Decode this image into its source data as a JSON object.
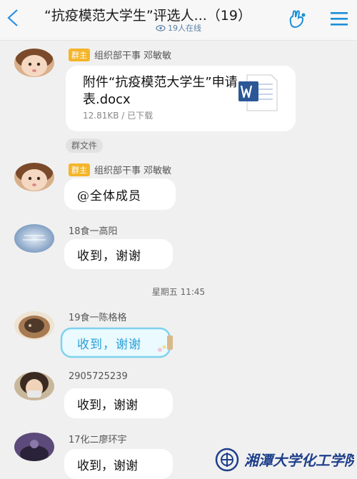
{
  "header": {
    "title": "“抗疫模范大学生”评选人...（19）",
    "online": "19人在线"
  },
  "messages": {
    "m1": {
      "badge": "群主",
      "sender": "组织部干事 邓敏敏",
      "file_name": "附件“抗疫模范大学生”申请表.docx",
      "file_meta": "12.81KB / 已下载",
      "tag": "群文件"
    },
    "m2": {
      "badge": "群主",
      "sender": "组织部干事 邓敏敏",
      "text": "@全体成员"
    },
    "m3": {
      "sender": "18食一高阳",
      "text": "收到，谢谢"
    },
    "timestamp": "星期五 11:45",
    "m4": {
      "sender": "19食一陈格格",
      "text": "收到，谢谢"
    },
    "m5": {
      "sender": "2905725239",
      "text": "收到，谢谢"
    },
    "m6": {
      "sender": "17化二廖环宇",
      "text": "收到，谢谢"
    }
  },
  "watermark": "湘潭大学化工学院",
  "colors": {
    "badge": "#f4b52a",
    "accent_blue": "#2a9fd6",
    "background": "#f0f0f0",
    "word_blue": "#2b5797"
  },
  "icons": {
    "back": "chevron-left-icon",
    "hand": "hand-gesture-icon",
    "menu": "hamburger-menu-icon",
    "online": "eye-icon",
    "file": "word-document-icon"
  }
}
